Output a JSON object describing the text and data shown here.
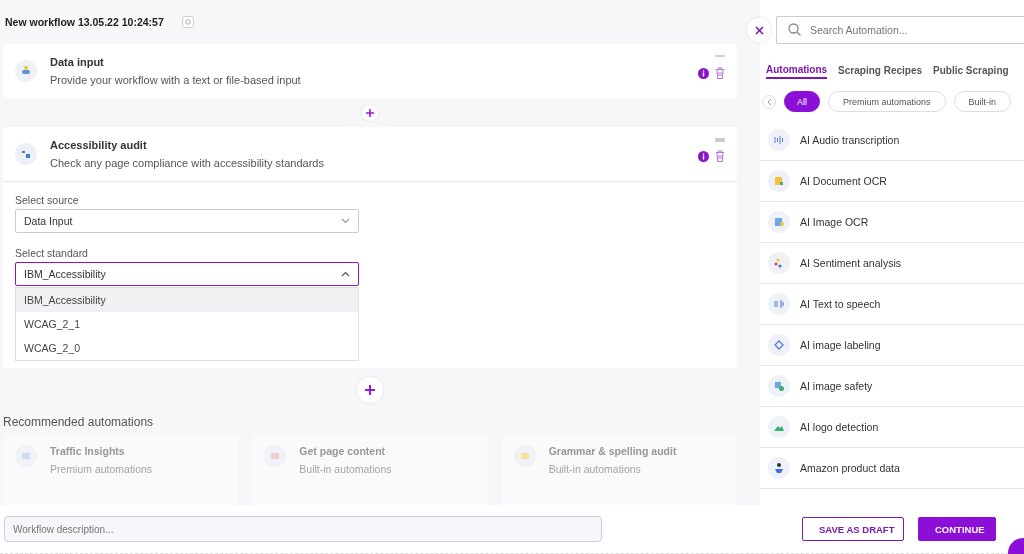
{
  "workflow": {
    "title": "New workflow 13.05.22 10:24:57"
  },
  "steps": [
    {
      "title": "Data input",
      "description": "Provide your workflow with a text or file-based input",
      "expanded": false
    },
    {
      "title": "Accessibility audit",
      "description": "Check any page compliance with accessibility standards",
      "expanded": true,
      "fields": [
        {
          "label": "Select source",
          "value": "Data Input",
          "open": false
        },
        {
          "label": "Select standard",
          "value": "IBM_Accessibility",
          "open": true,
          "options": [
            {
              "label": "IBM_Accessibility",
              "selected": true
            },
            {
              "label": "WCAG_2_1",
              "selected": false
            },
            {
              "label": "WCAG_2_0",
              "selected": false
            }
          ]
        }
      ]
    }
  ],
  "recommended": {
    "title": "Recommended automations",
    "items": [
      {
        "title": "Traffic Insights",
        "category": "Premium automations"
      },
      {
        "title": "Get page content",
        "category": "Built-in automations"
      },
      {
        "title": "Grammar & spelling audit",
        "category": "Built-in automations"
      }
    ]
  },
  "description_field": {
    "placeholder": "Workflow description..."
  },
  "buttons": [
    {
      "label": "SAVE AS DRAFT",
      "kind": "outline"
    },
    {
      "label": "CONTINUE",
      "kind": "primary"
    }
  ],
  "panel": {
    "search": {
      "placeholder": "Search Automation..."
    },
    "tabs": [
      {
        "label": "Automations",
        "selected": true
      },
      {
        "label": "Scraping Recipes",
        "selected": false
      },
      {
        "label": "Public Scraping",
        "selected": false
      }
    ],
    "filters": [
      {
        "label": "All",
        "selected": true
      },
      {
        "label": "Premium automations",
        "selected": false
      },
      {
        "label": "Built-in",
        "selected": false
      }
    ],
    "automations": [
      "AI Audio transcription",
      "AI Document OCR",
      "AI Image OCR",
      "AI Sentiment analysis",
      "AI Text to speech",
      "AI image labeling",
      "AI image safety",
      "AI logo detection",
      "Amazon product data"
    ]
  }
}
